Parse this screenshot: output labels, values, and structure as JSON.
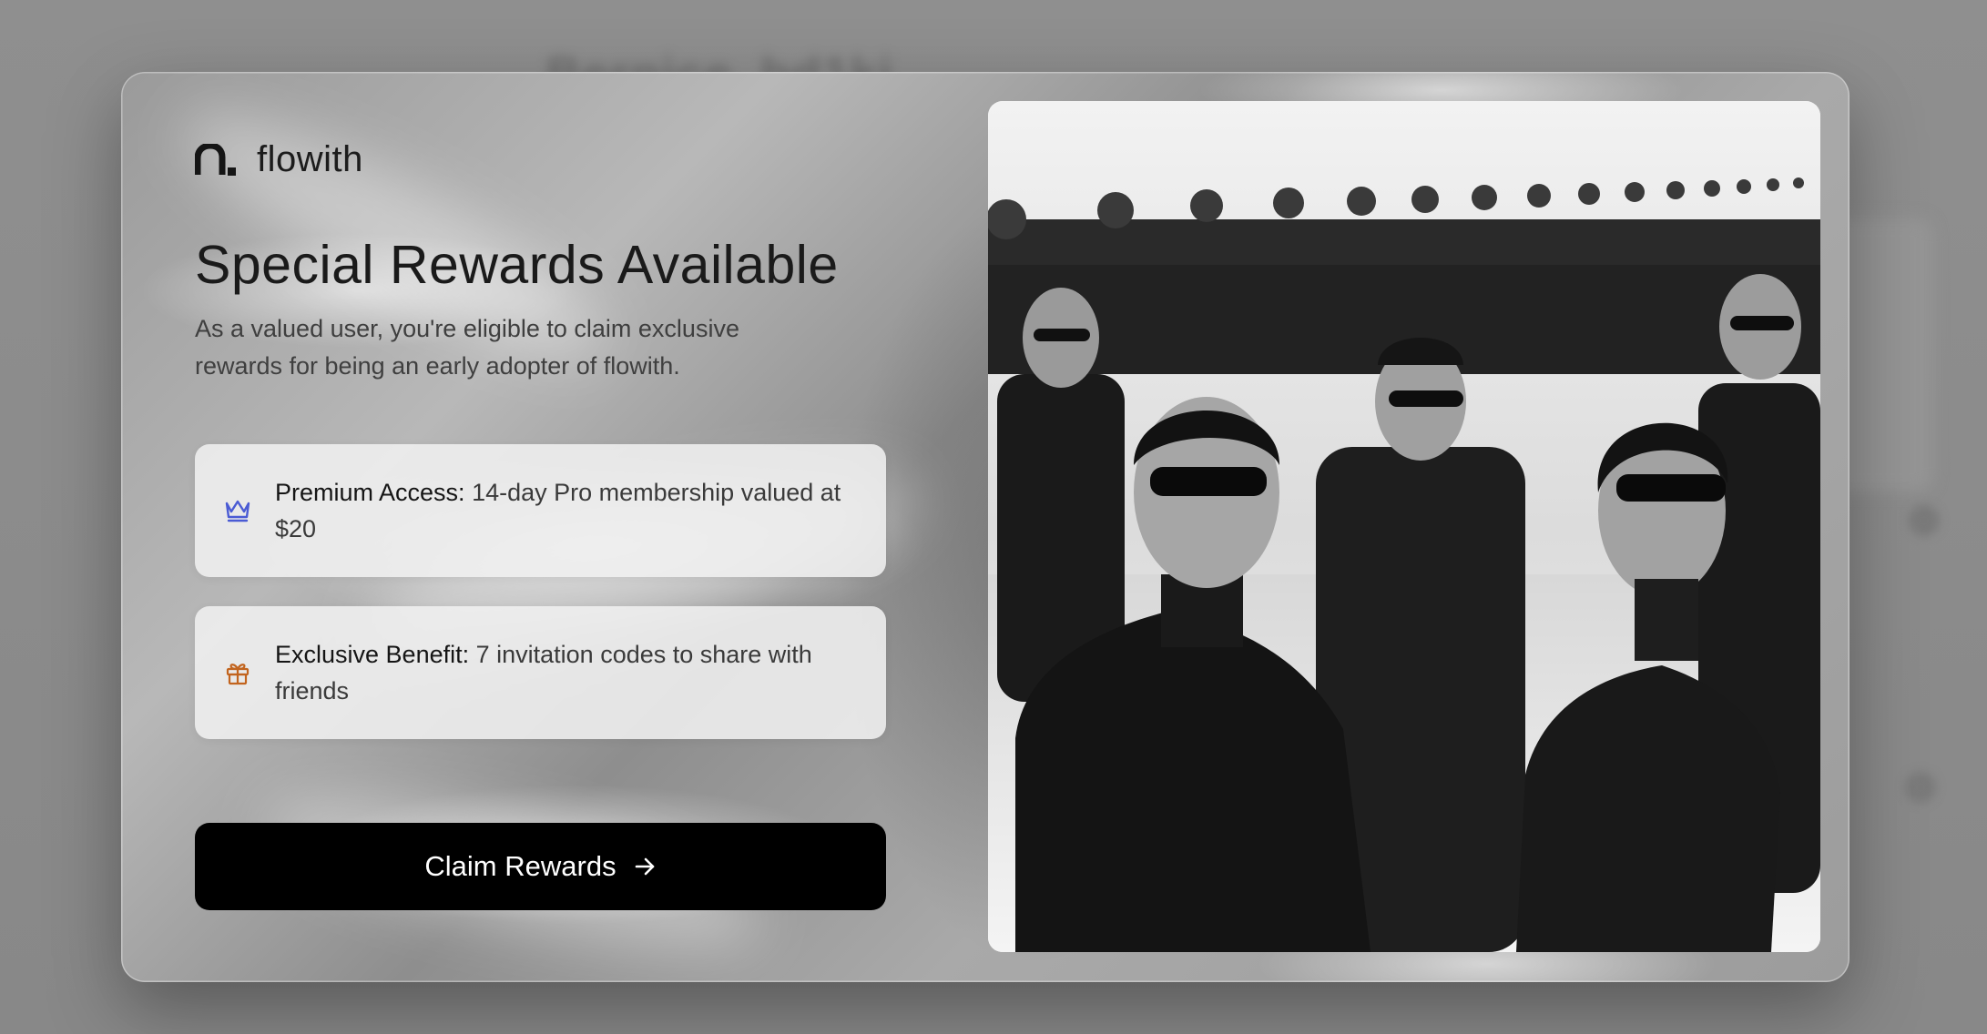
{
  "background": {
    "ghost_title": "Bernice_bd1ki"
  },
  "modal": {
    "brand": {
      "name": "flowith",
      "logo_icon": "flowith-logo-icon"
    },
    "title": "Special Rewards Available",
    "subtitle": "As a valued user, you're eligible to claim exclusive rewards for being an early adopter of flowith.",
    "rewards": [
      {
        "icon": "crown-icon",
        "icon_color": "#4a5bd4",
        "label": "Premium Access:",
        "description": " 14-day Pro membership valued at $20"
      },
      {
        "icon": "gift-icon",
        "icon_color": "#c2641e",
        "label": "Exclusive Benefit:",
        "description": " 7 invitation codes to share with friends"
      }
    ],
    "cta": {
      "label": "Claim Rewards",
      "icon": "arrow-right-icon"
    },
    "image": {
      "description_icon": "promo-photo"
    }
  },
  "colors": {
    "button_bg": "#000000",
    "button_text": "#ffffff",
    "card_bg": "#f0f0f0"
  }
}
